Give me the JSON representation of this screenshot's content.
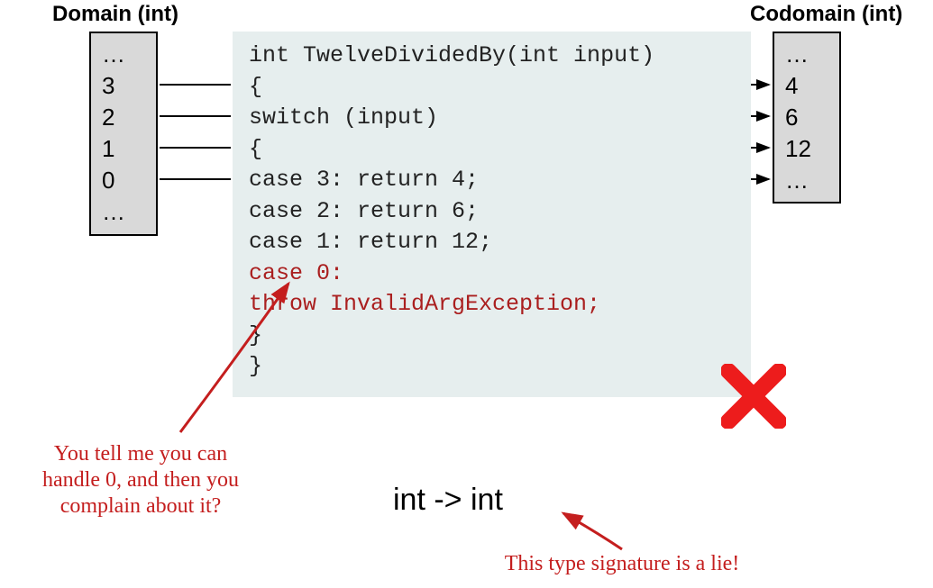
{
  "domain": {
    "title": "Domain (int)",
    "values": [
      "…",
      "3",
      "2",
      "1",
      "0",
      "…"
    ]
  },
  "codomain": {
    "title": "Codomain (int)",
    "values": [
      "…",
      "4",
      "6",
      "12",
      "…"
    ]
  },
  "code": {
    "line1": "int TwelveDividedBy(int input)",
    "line2": "{",
    "line3": "   switch (input)",
    "line4": "   {",
    "line5": "   case 3: return 4;",
    "line6": "   case 2: return 6;",
    "line7": "   case 1: return 12;",
    "line8": "   case 0:",
    "line9": "    throw InvalidArgException;",
    "line10": "   }",
    "line11": "}"
  },
  "type_signature": "int -> int",
  "annotations": {
    "left": "You tell me you can handle 0, and then you complain about it?",
    "bottom": "This type signature is a lie!"
  }
}
